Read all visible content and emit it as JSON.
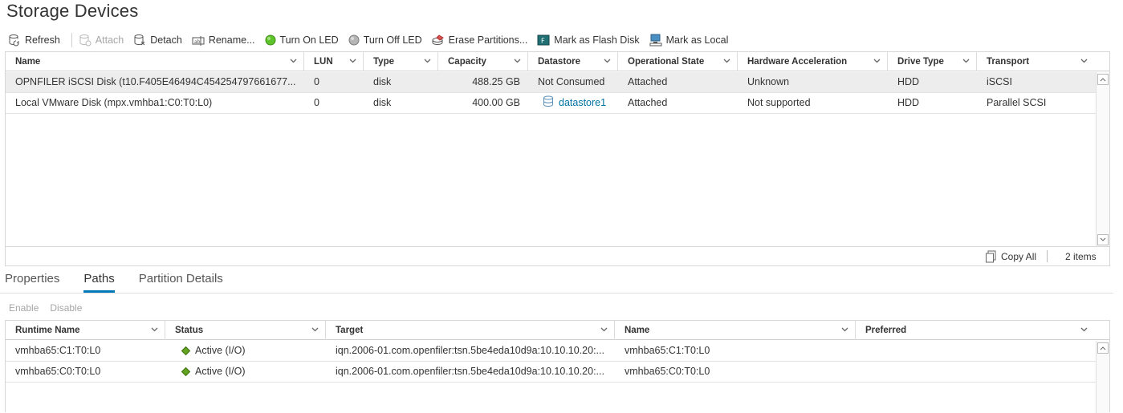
{
  "page": {
    "title": "Storage Devices"
  },
  "toolbar": {
    "refresh": "Refresh",
    "attach": "Attach",
    "detach": "Detach",
    "rename": "Rename...",
    "turn_on_led": "Turn On LED",
    "turn_off_led": "Turn Off LED",
    "erase_partitions": "Erase Partitions...",
    "mark_flash": "Mark as Flash Disk",
    "mark_local": "Mark as Local"
  },
  "devices": {
    "columns": [
      "Name",
      "LUN",
      "Type",
      "Capacity",
      "Datastore",
      "Operational State",
      "Hardware Acceleration",
      "Drive Type",
      "Transport"
    ],
    "rows": [
      [
        "OPNFILER iSCSI Disk (t10.F405E46494C454254797661677...",
        "0",
        "disk",
        "488.25 GB",
        "Not Consumed",
        "Attached",
        "Unknown",
        "HDD",
        "iSCSI"
      ],
      [
        "Local VMware Disk (mpx.vmhba1:C0:T0:L0)",
        "0",
        "disk",
        "400.00 GB",
        "datastore1",
        "Attached",
        "Not supported",
        "HDD",
        "Parallel SCSI"
      ]
    ],
    "footer": {
      "copy_all": "Copy All",
      "count": "2 items"
    }
  },
  "tabs": [
    "Properties",
    "Paths",
    "Partition Details"
  ],
  "paths_bar": {
    "enable": "Enable",
    "disable": "Disable"
  },
  "paths": {
    "columns": [
      "Runtime Name",
      "Status",
      "Target",
      "Name",
      "Preferred"
    ],
    "rows": [
      [
        "vmhba65:C1:T0:L0",
        "Active (I/O)",
        "iqn.2006-01.com.openfiler:tsn.5be4eda10d9a:10.10.10.20:...",
        "vmhba65:C1:T0:L0",
        ""
      ],
      [
        "vmhba65:C0:T0:L0",
        "Active (I/O)",
        "iqn.2006-01.com.openfiler:tsn.5be4eda10d9a:10.10.10.20:...",
        "vmhba65:C0:T0:L0",
        ""
      ]
    ]
  },
  "colors": {
    "accent": "#0079b8",
    "link": "#0072a3",
    "led_on": "#5ec22b",
    "led_off": "#9a9a9a",
    "status_active": "#62a420"
  }
}
